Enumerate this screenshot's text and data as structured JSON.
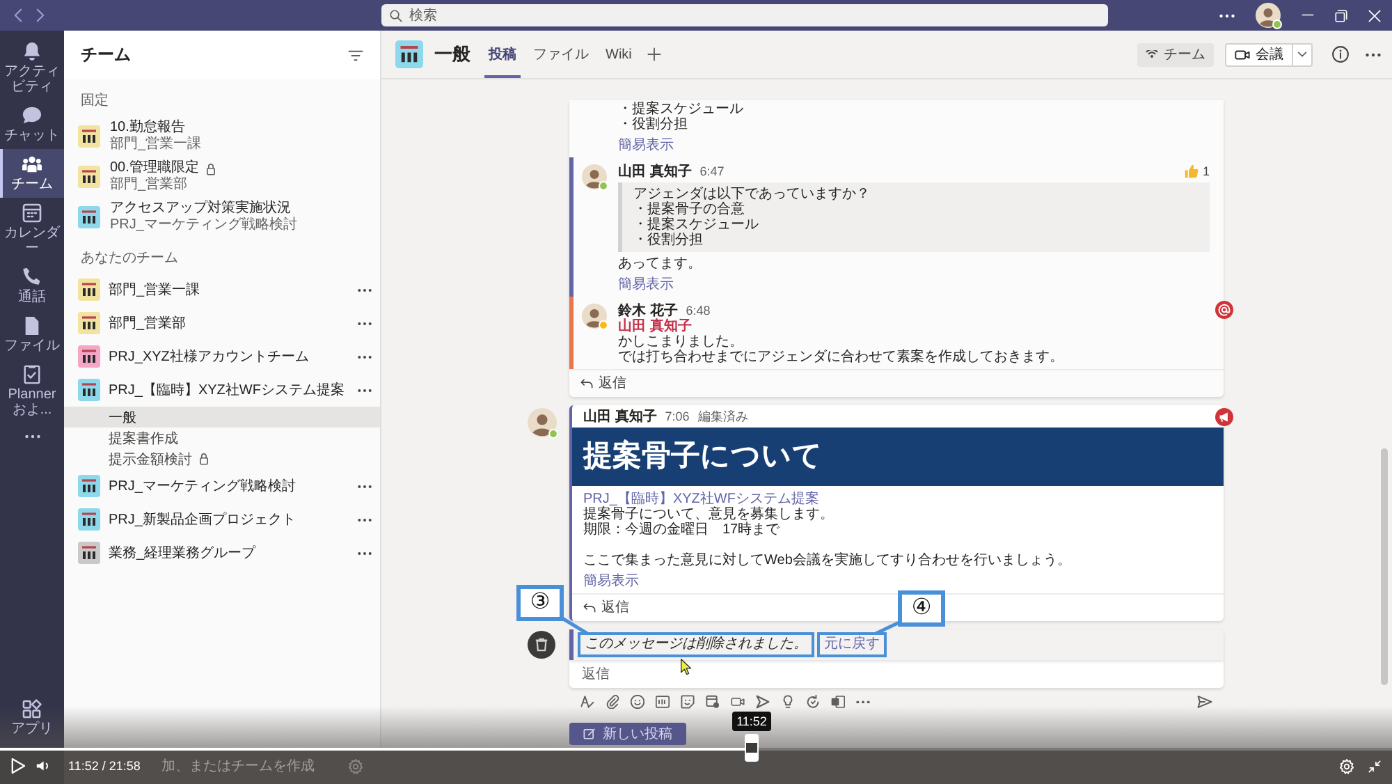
{
  "title_bar": {
    "search": {
      "placeholder": "検索"
    },
    "user": {
      "presence": {
        "color": "#92c353"
      }
    }
  },
  "app_bar": {
    "items": [
      {
        "label": "アクティビティ",
        "selected": false
      },
      {
        "label": "チャット",
        "selected": false
      },
      {
        "label": "チーム",
        "selected": true
      },
      {
        "label": "カレンダー",
        "selected": false
      },
      {
        "label": "通話",
        "selected": false
      },
      {
        "label": "ファイル",
        "selected": false
      },
      {
        "label": "Planner およ...",
        "selected": false
      }
    ],
    "apps": "アプリ"
  },
  "sidebar": {
    "title": "チーム",
    "sections": [
      {
        "kind": "pinned",
        "heading": "固定",
        "items": [
          {
            "name": "10.勤怠報告",
            "team": "部門_営業一課",
            "color": "#f3e3a0",
            "locked": false
          },
          {
            "name": "00.管理職限定",
            "team": "部門_営業部",
            "color": "#f3e3a0",
            "locked": true
          },
          {
            "name": "アクセスアップ対策実施状況",
            "team": "PRJ_マーケティング戦略検討",
            "color": "#8ed8ec",
            "locked": false
          }
        ]
      },
      {
        "kind": "teams",
        "heading": "あなたのチーム",
        "items": [
          {
            "name": "部門_営業一課",
            "color": "#f3e3a0"
          },
          {
            "name": "部門_営業部",
            "color": "#f3e3a0"
          },
          {
            "name": "PRJ_XYZ社様アカウントチーム",
            "color": "#f4a6c6"
          },
          {
            "name": "PRJ_【臨時】XYZ社WFシステム提案",
            "color": "#8ed8ec",
            "channels": [
              {
                "name": "一般",
                "selected": true,
                "locked": false
              },
              {
                "name": "提案書作成",
                "selected": false,
                "locked": false
              },
              {
                "name": "提示金額検討",
                "selected": false,
                "locked": true
              }
            ]
          },
          {
            "name": "PRJ_マーケティング戦略検討",
            "color": "#8ed8ec"
          },
          {
            "name": "PRJ_新製品企画プロジェクト",
            "color": "#8ed8ec"
          },
          {
            "name": "業務_経理業務グループ",
            "color": "#c9c9c9"
          }
        ]
      }
    ],
    "footer": "加、またはチームを作成"
  },
  "channel_header": {
    "title": "一般",
    "tabs": [
      {
        "label": "投稿",
        "selected": true
      },
      {
        "label": "ファイル",
        "selected": false
      },
      {
        "label": "Wiki",
        "selected": false
      }
    ],
    "team_button": "チーム",
    "meet_button": "会議"
  },
  "threads": [
    {
      "kind": "conversation",
      "tail_lines": [
        "・提案スケジュール",
        "・役割分担"
      ],
      "tail_link": "簡易表示",
      "replies": [
        {
          "author": "山田 真知子",
          "time": "6:47",
          "presence": {
            "color": "#92c353"
          },
          "color": "#6264a7",
          "likes": "1",
          "quote": [
            "アジェンダは以下であっていますか？",
            "・提案骨子の合意",
            "・提案スケジュール",
            "・役割分担"
          ],
          "body": [
            "あってます。"
          ],
          "link": "簡易表示",
          "mentioned_you": false
        },
        {
          "author": "鈴木 花子",
          "time": "6:48",
          "presence": {
            "color": "#fdb913"
          },
          "color": "#e97548",
          "mention": "山田 真知子",
          "body": [
            "かしこまりました。",
            "では打ち合わせまでにアジェンダに合わせて素案を作成しておきます。"
          ],
          "mentioned_you": true
        }
      ],
      "reply_label": "返信"
    },
    {
      "kind": "announcement",
      "author": "山田 真知子",
      "time": "7:06",
      "edited": "編集済み",
      "presence": {
        "color": "#92c353"
      },
      "headline": "提案骨子について",
      "channel_link": "PRJ_【臨時】XYZ社WFシステム提案",
      "paragraphs": [
        [
          "提案骨子について、意見を募集します。",
          "期限：今週の金曜日　17時まで"
        ],
        [
          "ここで集まった意見に対してWeb会議を実施してすり合わせを行いましょう。"
        ]
      ],
      "link": "簡易表示",
      "reply_label": "返信"
    },
    {
      "kind": "deleted",
      "color": "#6264a7",
      "notice": {
        "text": "このメッセージは削除されました。",
        "callout": "③"
      },
      "undo": {
        "text": "元に戻す",
        "callout": "④"
      },
      "reply_placeholder": "返信"
    }
  ],
  "new_post_button": "新しい投稿",
  "player": {
    "time": "11:52 / 21:58",
    "level": 0.54,
    "tooltip": "11:52"
  }
}
